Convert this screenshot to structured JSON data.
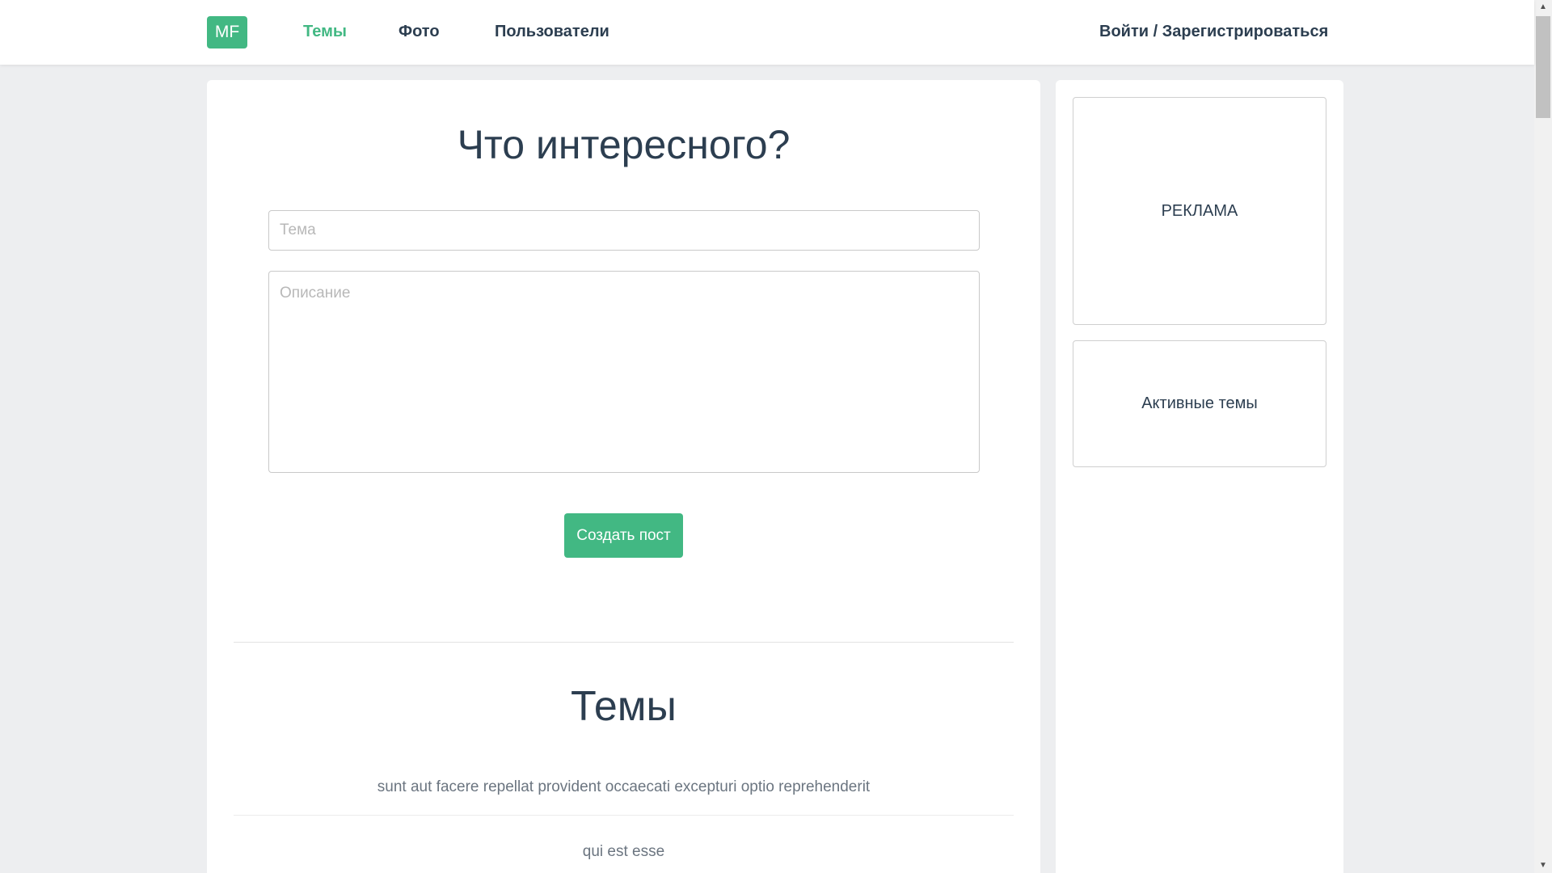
{
  "navbar": {
    "logo": "MF",
    "links": [
      {
        "label": "Темы",
        "active": true
      },
      {
        "label": "Фото",
        "active": false
      },
      {
        "label": "Пользователи",
        "active": false
      }
    ],
    "auth_label": "Войти / Зарегистрироваться"
  },
  "form": {
    "title": "Что интересного?",
    "topic_placeholder": "Тема",
    "description_placeholder": "Описание",
    "submit_label": "Создать пост"
  },
  "topics": {
    "title": "Темы",
    "items": [
      "sunt aut facere repellat provident occaecati excepturi optio reprehenderit",
      "qui est esse"
    ]
  },
  "sidebar": {
    "ad_label": "РЕКЛАМА",
    "active_topics_label": "Активные темы"
  },
  "colors": {
    "accent": "#42b883",
    "text": "#2c3e50",
    "background": "#edeef0"
  }
}
